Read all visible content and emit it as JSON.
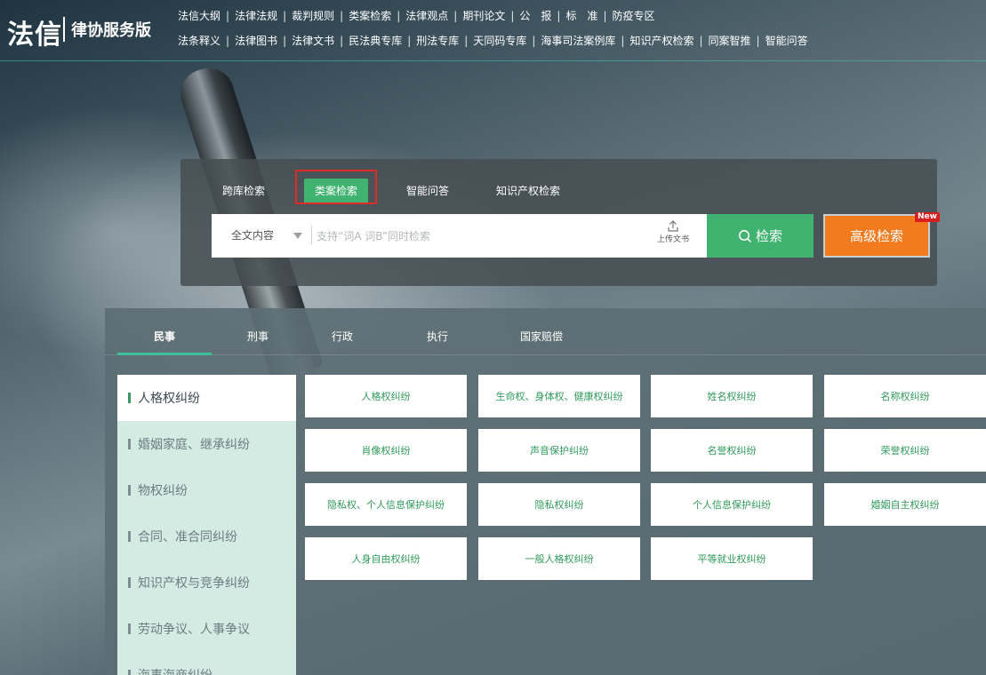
{
  "header": {
    "logo_main": "法信",
    "logo_sub": "律协服务版",
    "nav_row1": [
      "法信大纲",
      "法律法规",
      "裁判规则",
      "类案检索",
      "法律观点",
      "期刊论文",
      "公　报",
      "标　准",
      "防疫专区"
    ],
    "nav_row2": [
      "法条释义",
      "法律图书",
      "法律文书",
      "民法典专库",
      "刑法专库",
      "天同码专库",
      "海事司法案例库",
      "知识产权检索",
      "同案智推",
      "智能问答"
    ]
  },
  "search": {
    "tabs": [
      "跨库检索",
      "类案检索",
      "智能问答",
      "知识产权检索"
    ],
    "active_tab": "类案检索",
    "scope": "全文内容",
    "placeholder": "支持“词A 词B”同时检索",
    "upload_label": "上传文书",
    "search_label": "检索",
    "advanced_label": "高级检索",
    "new_badge": "New"
  },
  "categories": {
    "tabs": [
      "民事",
      "刑事",
      "行政",
      "执行",
      "国家赔偿"
    ],
    "active_tab": "民事",
    "sidebar": [
      "人格权纠纷",
      "婚姻家庭、继承纠纷",
      "物权纠纷",
      "合同、准合同纠纷",
      "知识产权与竞争纠纷",
      "劳动争议、人事争议",
      "海事海商纠纷"
    ],
    "active_sidebar": "人格权纠纷",
    "cards": [
      "人格权纠纷",
      "生命权、身体权、健康权纠纷",
      "姓名权纠纷",
      "名称权纠纷",
      "肖像权纠纷",
      "声音保护纠纷",
      "名誉权纠纷",
      "荣誉权纠纷",
      "隐私权、个人信息保护纠纷",
      "隐私权纠纷",
      "个人信息保护纠纷",
      "婚姻自主权纠纷",
      "人身自由权纠纷",
      "一般人格权纠纷",
      "平等就业权纠纷"
    ]
  },
  "colors": {
    "green": "#3fb36f",
    "orange": "#f27b20",
    "highlight_red": "#e02b2b",
    "card_text": "#2f9a5a"
  }
}
